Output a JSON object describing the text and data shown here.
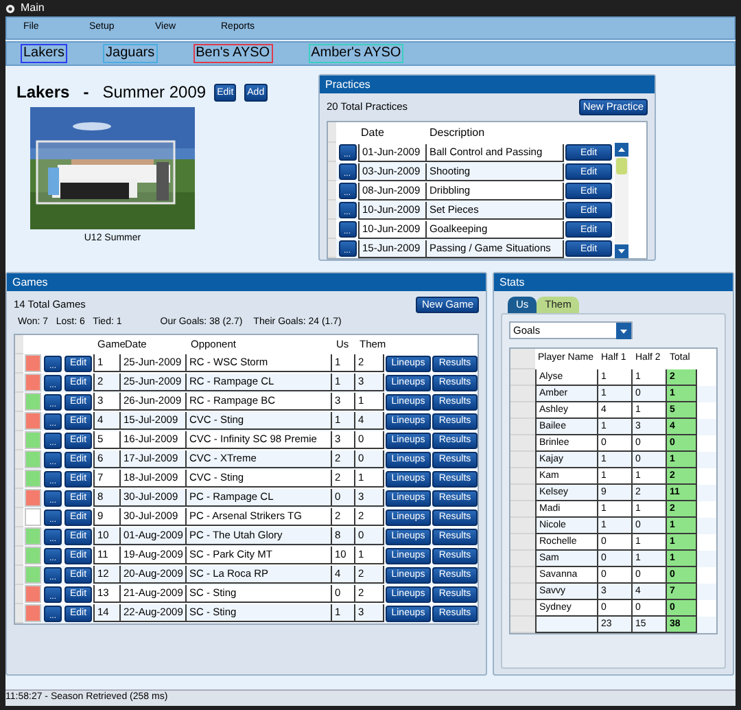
{
  "window": {
    "title": "Main"
  },
  "menu": [
    "File",
    "Setup",
    "View",
    "Reports"
  ],
  "teams": [
    {
      "label": "Lakers",
      "color": "#2b3cf0"
    },
    {
      "label": "Jaguars",
      "color": "#4aaee0"
    },
    {
      "label": "Ben's AYSO",
      "color": "#e03a4a"
    },
    {
      "label": "Amber's AYSO",
      "color": "#3ccfc0"
    }
  ],
  "team_header": {
    "team": "Lakers",
    "separator": "-",
    "season": "Summer 2009",
    "buttons": [
      "Edit",
      "Add"
    ],
    "photo": {
      "kind": "picture",
      "caption": "U12 Summer"
    }
  },
  "practices": {
    "title": "Practices",
    "total": "20 Total Practices",
    "new_button": "New Practice",
    "columns": [
      "Date",
      "Description"
    ],
    "rows": [
      {
        "menu": "...",
        "date": "01-Jun-2009",
        "description": "Ball Control and Passing",
        "edit": "Edit"
      },
      {
        "menu": "...",
        "date": "03-Jun-2009",
        "description": "Shooting",
        "edit": "Edit"
      },
      {
        "menu": "...",
        "date": "08-Jun-2009",
        "description": "Dribbling",
        "edit": "Edit"
      },
      {
        "menu": "...",
        "date": "10-Jun-2009",
        "description": "Set Pieces",
        "edit": "Edit"
      },
      {
        "menu": "...",
        "date": "10-Jun-2009",
        "description": "Goalkeeping",
        "edit": "Edit"
      },
      {
        "menu": "...",
        "date": "15-Jun-2009",
        "description": "Passing / Game Situations",
        "edit": "Edit"
      }
    ]
  },
  "games": {
    "title": "Games",
    "total": "14 Total Games",
    "new_button": "New Game",
    "record": "Won: 7   Lost: 6   Tied: 1",
    "our_goals": "Our Goals: 38 (2.7)",
    "their_goals": "Their Goals: 24 (1.7)",
    "columns": [
      "Game",
      "Date",
      "Opponent",
      "Us",
      "Them"
    ],
    "rows": [
      {
        "color": "#f47c6c",
        "menu": "...",
        "edit": "Edit",
        "game": "1",
        "date": "25-Jun-2009",
        "opponent": "RC - WSC Storm",
        "us": "1",
        "them": "2",
        "lineups": "Lineups",
        "results": "Results"
      },
      {
        "color": "#f47c6c",
        "menu": "...",
        "edit": "Edit",
        "game": "2",
        "date": "25-Jun-2009",
        "opponent": "RC - Rampage CL",
        "us": "1",
        "them": "3",
        "lineups": "Lineups",
        "results": "Results"
      },
      {
        "color": "#84dc7c",
        "menu": "...",
        "edit": "Edit",
        "game": "3",
        "date": "26-Jun-2009",
        "opponent": "RC - Rampage BC",
        "us": "3",
        "them": "1",
        "lineups": "Lineups",
        "results": "Results"
      },
      {
        "color": "#f47c6c",
        "menu": "...",
        "edit": "Edit",
        "game": "4",
        "date": "15-Jul-2009",
        "opponent": "CVC - Sting",
        "us": "1",
        "them": "4",
        "lineups": "Lineups",
        "results": "Results"
      },
      {
        "color": "#84dc7c",
        "menu": "...",
        "edit": "Edit",
        "game": "5",
        "date": "16-Jul-2009",
        "opponent": "CVC - Infinity SC 98 Premie",
        "us": "3",
        "them": "0",
        "lineups": "Lineups",
        "results": "Results"
      },
      {
        "color": "#84dc7c",
        "menu": "...",
        "edit": "Edit",
        "game": "6",
        "date": "17-Jul-2009",
        "opponent": "CVC - XTreme",
        "us": "2",
        "them": "0",
        "lineups": "Lineups",
        "results": "Results"
      },
      {
        "color": "#84dc7c",
        "menu": "...",
        "edit": "Edit",
        "game": "7",
        "date": "18-Jul-2009",
        "opponent": "CVC - Sting",
        "us": "2",
        "them": "1",
        "lineups": "Lineups",
        "results": "Results"
      },
      {
        "color": "#f47c6c",
        "menu": "...",
        "edit": "Edit",
        "game": "8",
        "date": "30-Jul-2009",
        "opponent": "PC - Rampage CL",
        "us": "0",
        "them": "3",
        "lineups": "Lineups",
        "results": "Results"
      },
      {
        "color": "#ffffff",
        "menu": "...",
        "edit": "Edit",
        "game": "9",
        "date": "30-Jul-2009",
        "opponent": "PC - Arsenal Strikers TG",
        "us": "2",
        "them": "2",
        "lineups": "Lineups",
        "results": "Results"
      },
      {
        "color": "#84dc7c",
        "menu": "...",
        "edit": "Edit",
        "game": "10",
        "date": "01-Aug-2009",
        "opponent": "PC - The Utah Glory",
        "us": "8",
        "them": "0",
        "lineups": "Lineups",
        "results": "Results"
      },
      {
        "color": "#84dc7c",
        "menu": "...",
        "edit": "Edit",
        "game": "11",
        "date": "19-Aug-2009",
        "opponent": "SC - Park City MT",
        "us": "10",
        "them": "1",
        "lineups": "Lineups",
        "results": "Results"
      },
      {
        "color": "#84dc7c",
        "menu": "...",
        "edit": "Edit",
        "game": "12",
        "date": "20-Aug-2009",
        "opponent": "SC - La Roca RP",
        "us": "4",
        "them": "2",
        "lineups": "Lineups",
        "results": "Results"
      },
      {
        "color": "#f47c6c",
        "menu": "...",
        "edit": "Edit",
        "game": "13",
        "date": "21-Aug-2009",
        "opponent": "SC - Sting",
        "us": "0",
        "them": "2",
        "lineups": "Lineups",
        "results": "Results"
      },
      {
        "color": "#f47c6c",
        "menu": "...",
        "edit": "Edit",
        "game": "14",
        "date": "22-Aug-2009",
        "opponent": "SC - Sting",
        "us": "1",
        "them": "3",
        "lineups": "Lineups",
        "results": "Results"
      }
    ]
  },
  "stats": {
    "title": "Stats",
    "tabs": [
      {
        "label": "Us",
        "selected": true
      },
      {
        "label": "Them",
        "selected": false
      }
    ],
    "stat_select": "Goals",
    "columns": [
      "Player Name",
      "Half 1",
      "Half 2",
      "Total"
    ],
    "rows": [
      {
        "name": "Alyse",
        "half1": "1",
        "half2": "1",
        "total": "2"
      },
      {
        "name": "Amber",
        "half1": "1",
        "half2": "0",
        "total": "1"
      },
      {
        "name": "Ashley",
        "half1": "4",
        "half2": "1",
        "total": "5"
      },
      {
        "name": "Bailee",
        "half1": "1",
        "half2": "3",
        "total": "4"
      },
      {
        "name": "Brinlee",
        "half1": "0",
        "half2": "0",
        "total": "0"
      },
      {
        "name": "Kajay",
        "half1": "1",
        "half2": "0",
        "total": "1"
      },
      {
        "name": "Kam",
        "half1": "1",
        "half2": "1",
        "total": "2"
      },
      {
        "name": "Kelsey",
        "half1": "9",
        "half2": "2",
        "total": "11"
      },
      {
        "name": "Madi",
        "half1": "1",
        "half2": "1",
        "total": "2"
      },
      {
        "name": "Nicole",
        "half1": "1",
        "half2": "0",
        "total": "1"
      },
      {
        "name": "Rochelle",
        "half1": "0",
        "half2": "1",
        "total": "1"
      },
      {
        "name": "Sam",
        "half1": "0",
        "half2": "1",
        "total": "1"
      },
      {
        "name": "Savanna",
        "half1": "0",
        "half2": "0",
        "total": "0"
      },
      {
        "name": "Savvy",
        "half1": "3",
        "half2": "4",
        "total": "7"
      },
      {
        "name": "Sydney",
        "half1": "0",
        "half2": "0",
        "total": "0"
      }
    ],
    "totals": {
      "half1": "23",
      "half2": "15",
      "total": "38"
    }
  },
  "status_bar": "11:58:27 - Season Retrieved (258 ms)"
}
